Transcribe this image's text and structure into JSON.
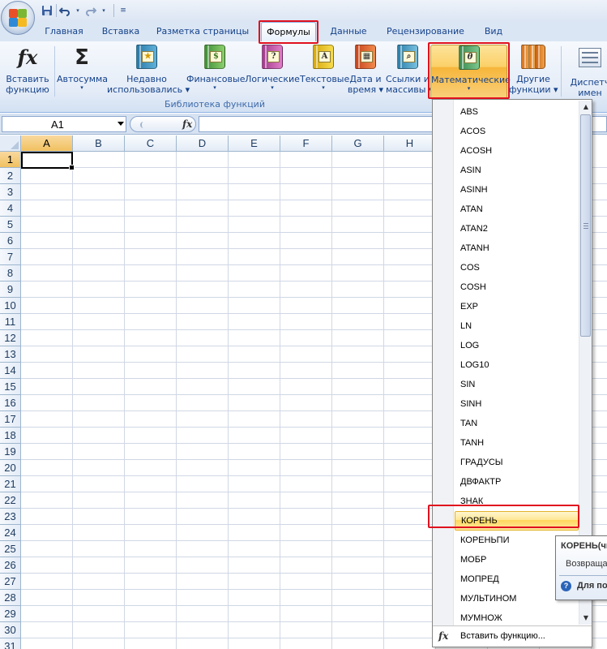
{
  "quick_access": {
    "save_icon": "save-icon",
    "undo_icon": "undo-icon",
    "redo_icon": "redo-icon"
  },
  "tabs": [
    {
      "label": "Главная"
    },
    {
      "label": "Вставка"
    },
    {
      "label": "Разметка страницы"
    },
    {
      "label": "Формулы"
    },
    {
      "label": "Данные"
    },
    {
      "label": "Рецензирование"
    },
    {
      "label": "Вид"
    }
  ],
  "ribbon": {
    "group_label": "Библиотека функций",
    "buttons": [
      {
        "line1": "Вставить",
        "line2": "функцию",
        "icon": "fx"
      },
      {
        "line1": "Автосумма",
        "line2": "▾",
        "icon": "Σ"
      },
      {
        "line1": "Недавно",
        "line2": "использовались ▾",
        "icon": "★"
      },
      {
        "line1": "Финансовые",
        "line2": "▾",
        "icon": "$"
      },
      {
        "line1": "Логические",
        "line2": "▾",
        "icon": "?"
      },
      {
        "line1": "Текстовые",
        "line2": "▾",
        "icon": "A"
      },
      {
        "line1": "Дата и",
        "line2": "время ▾",
        "icon": "▦"
      },
      {
        "line1": "Ссылки и",
        "line2": "массивы ▾",
        "icon": "⌕"
      },
      {
        "line1": "Математические",
        "line2": "▾",
        "icon": "θ"
      },
      {
        "line1": "Другие",
        "line2": "функции ▾",
        "icon": ""
      },
      {
        "line1": "Диспетч",
        "line2": "имен",
        "icon": "▤"
      }
    ]
  },
  "formula_bar": {
    "name_box": "A1",
    "fx_label": "fx",
    "formula": ""
  },
  "sheet": {
    "columns": [
      "A",
      "B",
      "C",
      "D",
      "E",
      "F",
      "G",
      "H"
    ],
    "rows": [
      "1",
      "2",
      "3",
      "4",
      "5",
      "6",
      "7",
      "8",
      "9",
      "10",
      "11",
      "12",
      "13",
      "14",
      "15",
      "16",
      "17",
      "18",
      "19",
      "20",
      "21",
      "22",
      "23",
      "24",
      "25",
      "26",
      "27",
      "28",
      "29",
      "30",
      "31"
    ],
    "active_cell": "A1"
  },
  "menu": {
    "items": [
      "ABS",
      "ACOS",
      "ACOSH",
      "ASIN",
      "ASINH",
      "ATAN",
      "ATAN2",
      "ATANH",
      "COS",
      "COSH",
      "EXP",
      "LN",
      "LOG",
      "LOG10",
      "SIN",
      "SINH",
      "TAN",
      "TANH",
      "ГРАДУСЫ",
      "ДВФАКТР",
      "ЗНАК",
      "КОРЕНЬ",
      "КОРЕНЬПИ",
      "МОБР",
      "МОПРЕД",
      "МУЛЬТИНОМ",
      "МУМНОЖ"
    ],
    "highlighted": "КОРЕНЬ",
    "footer_label": "Вставить функцию..."
  },
  "tooltip": {
    "title": "КОРЕНЬ(чи",
    "desc": "Возвраща",
    "help": "Для по"
  },
  "colors": {
    "highlight_box": "#e0101e",
    "ribbon_text": "#15428b",
    "menu_highlight": "#ffd75c"
  }
}
